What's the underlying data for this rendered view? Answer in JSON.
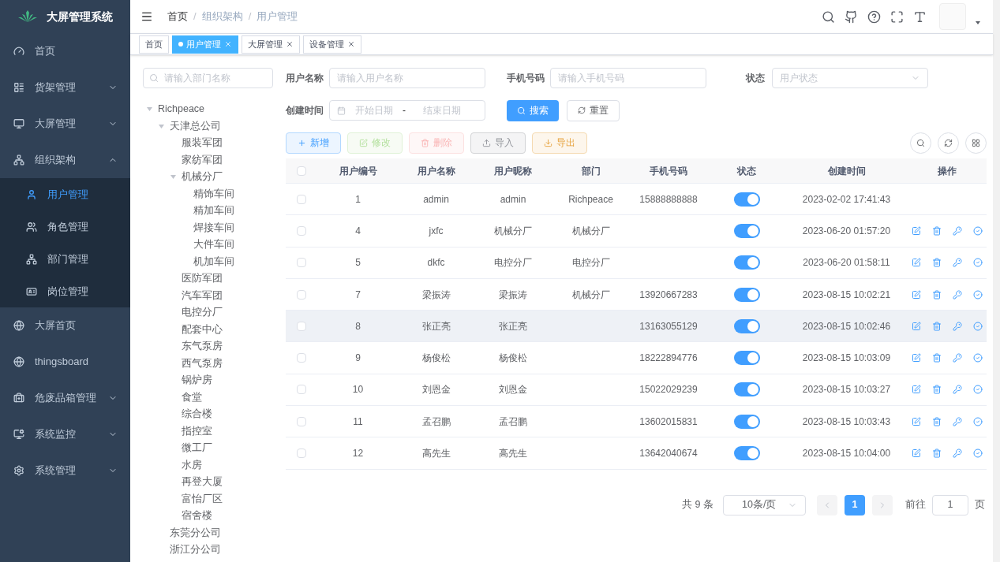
{
  "app": {
    "title": "大屏管理系统"
  },
  "sidebar": {
    "items": [
      {
        "label": "首页",
        "submenu": false
      },
      {
        "label": "货架管理",
        "submenu": true,
        "expanded": false
      },
      {
        "label": "大屏管理",
        "submenu": true,
        "expanded": false
      },
      {
        "label": "组织架构",
        "submenu": true,
        "expanded": true,
        "children": [
          {
            "label": "用户管理",
            "selected": true
          },
          {
            "label": "角色管理",
            "selected": false
          },
          {
            "label": "部门管理",
            "selected": false
          },
          {
            "label": "岗位管理",
            "selected": false
          }
        ]
      },
      {
        "label": "大屏首页",
        "submenu": false
      },
      {
        "label": "thingsboard",
        "submenu": false
      },
      {
        "label": "危废品箱管理",
        "submenu": true,
        "expanded": false
      },
      {
        "label": "系统监控",
        "submenu": true,
        "expanded": false
      },
      {
        "label": "系统管理",
        "submenu": true,
        "expanded": false
      }
    ]
  },
  "breadcrumb": {
    "separator": "/",
    "items": [
      "首页",
      "组织架构",
      "用户管理"
    ]
  },
  "tags": [
    {
      "label": "首页",
      "selected": false,
      "closable": false
    },
    {
      "label": "用户管理",
      "selected": true,
      "closable": true
    },
    {
      "label": "大屏管理",
      "selected": false,
      "closable": true
    },
    {
      "label": "设备管理",
      "selected": false,
      "closable": true
    }
  ],
  "dept_search": {
    "placeholder": "请输入部门名称"
  },
  "dept_tree": [
    {
      "label": "Richpeace",
      "expanded": true,
      "children": [
        {
          "label": "天津总公司",
          "expanded": true,
          "children": [
            {
              "label": "服装军团"
            },
            {
              "label": "家纺军团"
            },
            {
              "label": "机械分厂",
              "expanded": true,
              "children": [
                {
                  "label": "精饰车间"
                },
                {
                  "label": "精加车间"
                },
                {
                  "label": "焊接车间"
                },
                {
                  "label": "大件车间"
                },
                {
                  "label": "机加车间"
                }
              ]
            },
            {
              "label": "医防军团"
            },
            {
              "label": "汽车军团"
            },
            {
              "label": "电控分厂"
            },
            {
              "label": "配套中心"
            },
            {
              "label": "东气泵房"
            },
            {
              "label": "西气泵房"
            },
            {
              "label": "锅炉房"
            },
            {
              "label": "食堂"
            },
            {
              "label": "综合楼"
            },
            {
              "label": "指控室"
            },
            {
              "label": "微工厂"
            },
            {
              "label": "水房"
            },
            {
              "label": "再登大厦"
            },
            {
              "label": "富怡厂区"
            },
            {
              "label": "宿舍楼"
            }
          ]
        },
        {
          "label": "东莞分公司"
        },
        {
          "label": "浙江分公司"
        }
      ]
    }
  ],
  "filters": {
    "username": {
      "label": "用户名称",
      "placeholder": "请输入用户名称"
    },
    "phone": {
      "label": "手机号码",
      "placeholder": "请输入手机号码"
    },
    "status": {
      "label": "状态",
      "placeholder": "用户状态"
    },
    "created": {
      "label": "创建时间",
      "start_placeholder": "开始日期",
      "separator": "-",
      "end_placeholder": "结束日期"
    },
    "search_button": "搜索",
    "reset_button": "重置"
  },
  "toolbar": [
    {
      "kind": "add",
      "label": "新增",
      "disabled": false
    },
    {
      "kind": "edit",
      "label": "修改",
      "disabled": true
    },
    {
      "kind": "delete",
      "label": "删除",
      "disabled": true
    },
    {
      "kind": "import",
      "label": "导入",
      "disabled": false
    },
    {
      "kind": "export",
      "label": "导出",
      "disabled": false
    }
  ],
  "table": {
    "header_checked": false,
    "columns": [
      "用户编号",
      "用户名称",
      "用户昵称",
      "部门",
      "手机号码",
      "状态",
      "创建时间",
      "操作"
    ],
    "rows": [
      {
        "checked": false,
        "hovered": false,
        "actions": false,
        "on": true,
        "cells": [
          "1",
          "admin",
          "admin",
          "Richpeace",
          "15888888888",
          "2023-02-02 17:41:43"
        ]
      },
      {
        "checked": false,
        "hovered": false,
        "actions": true,
        "on": true,
        "cells": [
          "4",
          "jxfc",
          "机械分厂",
          "机械分厂",
          "",
          "2023-06-20 01:57:20"
        ]
      },
      {
        "checked": false,
        "hovered": false,
        "actions": true,
        "on": true,
        "cells": [
          "5",
          "dkfc",
          "电控分厂",
          "电控分厂",
          "",
          "2023-06-20 01:58:11"
        ]
      },
      {
        "checked": false,
        "hovered": false,
        "actions": true,
        "on": true,
        "cells": [
          "7",
          "梁振涛",
          "梁振涛",
          "机械分厂",
          "13920667283",
          "2023-08-15 10:02:21"
        ]
      },
      {
        "checked": false,
        "hovered": true,
        "actions": true,
        "on": true,
        "cells": [
          "8",
          "张正亮",
          "张正亮",
          "",
          "13163055129",
          "2023-08-15 10:02:46"
        ]
      },
      {
        "checked": false,
        "hovered": false,
        "actions": true,
        "on": true,
        "cells": [
          "9",
          "杨俊松",
          "杨俊松",
          "",
          "18222894776",
          "2023-08-15 10:03:09"
        ]
      },
      {
        "checked": false,
        "hovered": false,
        "actions": true,
        "on": true,
        "cells": [
          "10",
          "刘恩金",
          "刘恩金",
          "",
          "15022029239",
          "2023-08-15 10:03:27"
        ]
      },
      {
        "checked": false,
        "hovered": false,
        "actions": true,
        "on": true,
        "cells": [
          "11",
          "孟召鹏",
          "孟召鹏",
          "",
          "13602015831",
          "2023-08-15 10:03:43"
        ]
      },
      {
        "checked": false,
        "hovered": false,
        "actions": true,
        "on": true,
        "cells": [
          "12",
          "高先生",
          "高先生",
          "",
          "13642040674",
          "2023-08-15 10:04:00"
        ]
      }
    ]
  },
  "pagination": {
    "total": "共 9 条",
    "page_size": "10条/页",
    "pages": [
      {
        "label": "1",
        "selected": true
      }
    ],
    "goto_label": "前往",
    "goto_value": "1",
    "page_suffix": "页"
  }
}
